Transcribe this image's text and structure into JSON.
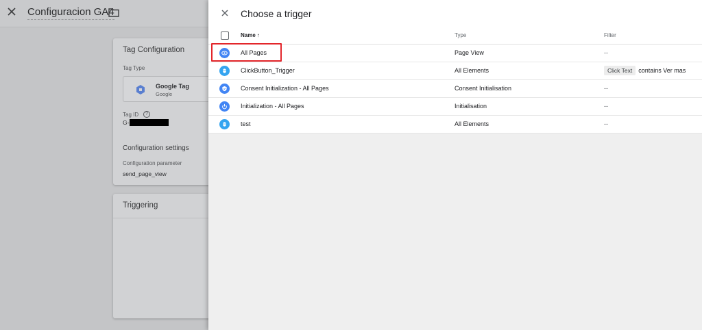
{
  "editor": {
    "title": "Configuracion GA4",
    "config_card": {
      "title": "Tag Configuration",
      "tag_type_label": "Tag Type",
      "tag_type_name": "Google Tag",
      "tag_type_vendor": "Google",
      "tag_id_label": "Tag ID",
      "tag_id_prefix": "G-",
      "config_settings_label": "Configuration settings",
      "config_param_label": "Configuration parameter",
      "config_param_value": "send_page_view"
    },
    "trigger_card": {
      "title": "Triggering"
    }
  },
  "drawer": {
    "title": "Choose a trigger",
    "columns": {
      "name": "Name",
      "sort": "↑",
      "type": "Type",
      "filter": "Filter"
    },
    "rows": [
      {
        "icon": "eye-icon",
        "name": "All Pages",
        "type": "Page View",
        "filter": "--"
      },
      {
        "icon": "click-icon",
        "name": "ClickButton_Trigger",
        "type": "All Elements",
        "filter_chip": "Click Text",
        "filter": "contains Ver mas"
      },
      {
        "icon": "shield-icon",
        "name": "Consent Initialization - All Pages",
        "type": "Consent Initialisation",
        "filter": "--"
      },
      {
        "icon": "power-icon",
        "name": "Initialization - All Pages",
        "type": "Initialisation",
        "filter": "--"
      },
      {
        "icon": "click-icon",
        "name": "test",
        "type": "All Elements",
        "filter": "--"
      }
    ]
  },
  "colors": {
    "accent": "#4285f4",
    "highlight": "#e3262b"
  }
}
